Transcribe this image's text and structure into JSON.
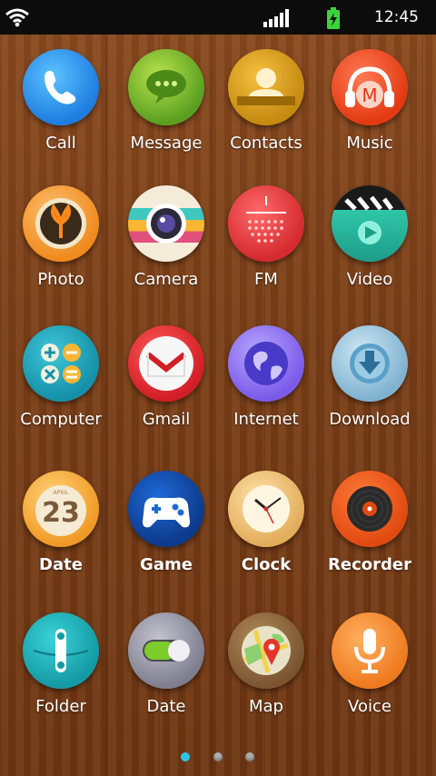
{
  "status_bar": {
    "time": "12:45"
  },
  "apps": [
    {
      "label": "Call",
      "icon": "phone-icon"
    },
    {
      "label": "Message",
      "icon": "message-icon"
    },
    {
      "label": "Contacts",
      "icon": "contacts-icon"
    },
    {
      "label": "Music",
      "icon": "music-icon",
      "glyph": "M"
    },
    {
      "label": "Photo",
      "icon": "photo-icon"
    },
    {
      "label": "Camera",
      "icon": "camera-icon"
    },
    {
      "label": "FM",
      "icon": "fm-radio-icon"
    },
    {
      "label": "Video",
      "icon": "video-icon"
    },
    {
      "label": "Computer",
      "icon": "calculator-icon"
    },
    {
      "label": "Gmail",
      "icon": "gmail-icon"
    },
    {
      "label": "Internet",
      "icon": "globe-icon"
    },
    {
      "label": "Download",
      "icon": "download-icon"
    },
    {
      "label": "Date",
      "icon": "calendar-icon",
      "month": "APRIL",
      "day": "23"
    },
    {
      "label": "Game",
      "icon": "gamepad-icon"
    },
    {
      "label": "Clock",
      "icon": "clock-icon"
    },
    {
      "label": "Recorder",
      "icon": "recorder-icon"
    },
    {
      "label": "Folder",
      "icon": "folder-icon"
    },
    {
      "label": "Date",
      "icon": "toggle-icon"
    },
    {
      "label": "Map",
      "icon": "map-icon"
    },
    {
      "label": "Voice",
      "icon": "microphone-icon"
    }
  ],
  "pager": {
    "current_page": 1,
    "page_count": 3
  },
  "colors": {
    "active_dot": "#2ec4e6",
    "inactive_dot": "#b0b0b0"
  }
}
